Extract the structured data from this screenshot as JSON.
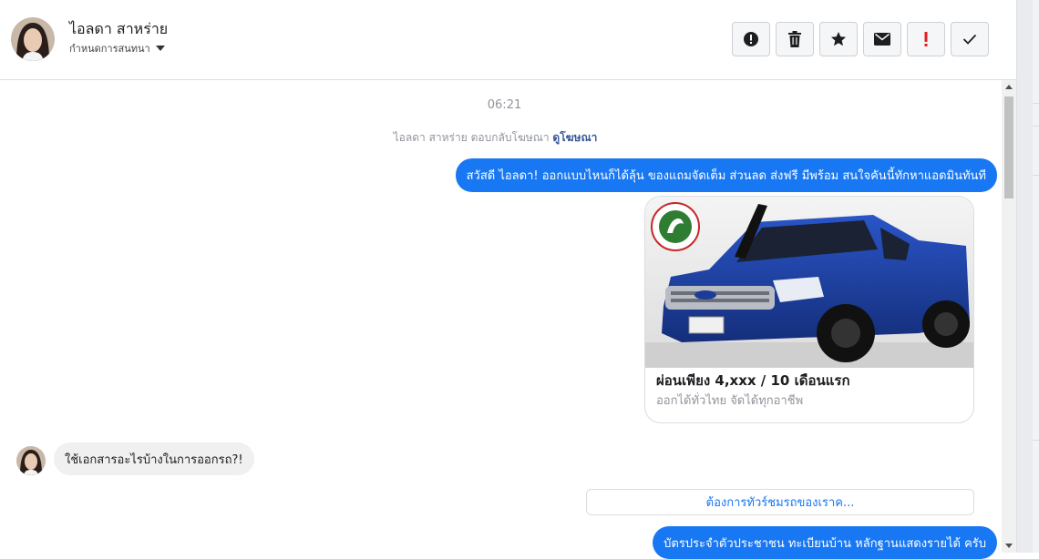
{
  "header": {
    "contact_name": "ไอลดา สาหร่าย",
    "label_dropdown": "กำหนดการสนทนา"
  },
  "toolbar": {
    "buttons": [
      {
        "name": "spam-icon",
        "label": "Mark as spam"
      },
      {
        "name": "trash-icon",
        "label": "Delete"
      },
      {
        "name": "star-icon",
        "label": "Star"
      },
      {
        "name": "envelope-icon",
        "label": "Mark as unread"
      },
      {
        "name": "exclamation-icon",
        "label": "Follow up"
      },
      {
        "name": "checkmark-icon",
        "label": "Mark as done"
      }
    ],
    "accent_red": "#e02020"
  },
  "conversation": {
    "timestamp": "06:21",
    "context_text": "ไอลดา สาหร่าย ตอบกลับโฆษณา",
    "context_link": "ดูโฆษณา",
    "messages": [
      {
        "from": "page",
        "text": "สวัสดี ไอลดา! ออกแบบไหนก็ได้ลุ้น ของแถมจัดเต็ม ส่วนลด ส่งฟรี มีพร้อม สนใจคันนี้ทักหาแอดมินทันที"
      },
      {
        "from": "user",
        "text": "ใช้เอกสารอะไรบ้างในการออกรถ?!"
      },
      {
        "from": "page",
        "text": "บัตรประจำตัวประชาชน ทะเบียนบ้าน หลักฐานแสดงรายได้ ครับ"
      }
    ],
    "ad_card": {
      "title": "ผ่อนเพียง 4,xxx / 10 เดือนแรก",
      "subtitle": "ออกได้ทั่วไทย จัดได้ทุกอาชีพ",
      "image": "blue-pickup-truck"
    },
    "quick_reply": "ต้องการทัวร์ชมรถของเราค..."
  },
  "colors": {
    "bubble_out": "#1877f2",
    "bubble_in": "#f1f0f0"
  }
}
